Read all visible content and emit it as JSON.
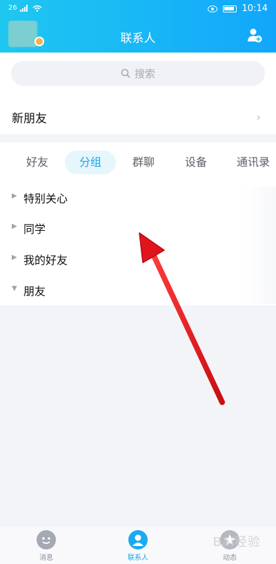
{
  "status_bar": {
    "signal": "26",
    "time": "10:14"
  },
  "header": {
    "title": "联系人"
  },
  "search": {
    "placeholder": "搜索"
  },
  "new_friends": {
    "label": "新朋友"
  },
  "tabs": [
    {
      "label": "好友",
      "active": false
    },
    {
      "label": "分组",
      "active": true
    },
    {
      "label": "群聊",
      "active": false
    },
    {
      "label": "设备",
      "active": false
    },
    {
      "label": "通讯录",
      "active": false
    }
  ],
  "groups": [
    {
      "label": "特别关心",
      "expanded": false
    },
    {
      "label": "同学",
      "expanded": false
    },
    {
      "label": "我的好友",
      "expanded": false
    },
    {
      "label": "朋友",
      "expanded": true
    }
  ],
  "bottom_nav": [
    {
      "label": "消息",
      "icon": "chat-face-icon",
      "active": false
    },
    {
      "label": "联系人",
      "icon": "contacts-icon",
      "active": true
    },
    {
      "label": "动态",
      "icon": "star-icon",
      "active": false
    }
  ],
  "watermark": "Bai经验",
  "colors": {
    "accent": "#1aa7e8",
    "annotation_arrow": "#e2141b"
  }
}
